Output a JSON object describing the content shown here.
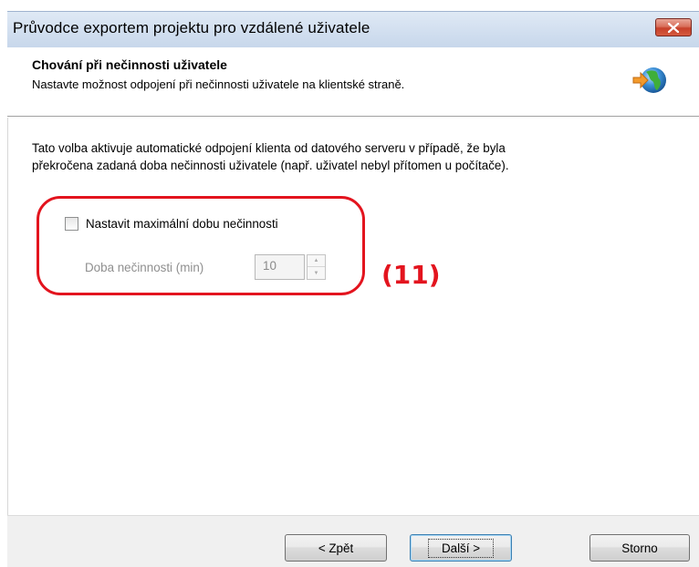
{
  "window": {
    "title": "Průvodce exportem projektu pro vzdálené uživatele"
  },
  "header": {
    "title": "Chování při nečinnosti uživatele",
    "subtitle": "Nastavte možnost odpojení při nečinnosti uživatele na klientské straně.",
    "icon": "globe-arrow-icon"
  },
  "body": {
    "description_line1": "Tato volba aktivuje automatické odpojení klienta od datového serveru v případě, že byla",
    "description_line2": "překročena zadaná doba nečinnosti uživatele (např. uživatel nebyl přítomen u počítače).",
    "checkbox_label": "Nastavit maximální dobu nečinnosti",
    "checkbox_checked": false,
    "timeout_label": "Doba nečinnosti (min)",
    "timeout_value": "10",
    "annotation": "(11)",
    "annotation_color": "#e3141e"
  },
  "footer": {
    "back_label": "< Zpět",
    "next_label": "Další >",
    "cancel_label": "Storno"
  }
}
